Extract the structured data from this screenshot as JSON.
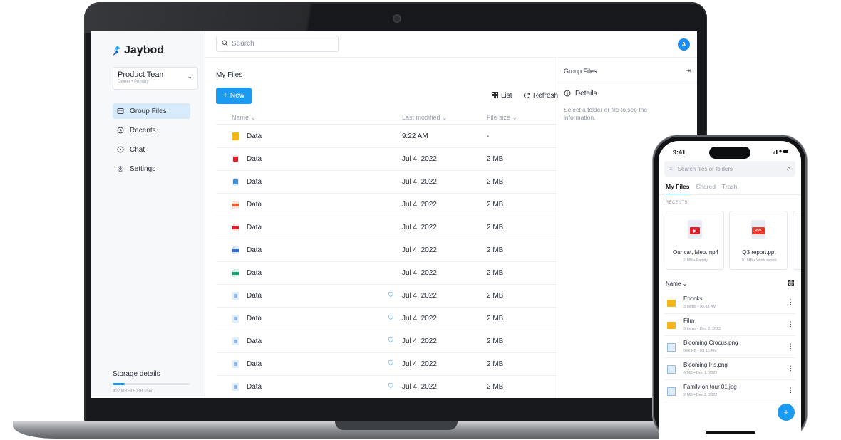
{
  "app": {
    "logo_text": "Jaybod",
    "colors": {
      "accent": "#1a9af0",
      "sidebar_bg": "#f7f8fa",
      "folder": "#f3b619",
      "danger": "#e1202c"
    }
  },
  "team": {
    "name": "Product Team",
    "subtitle": "Owner • Primary"
  },
  "sidebar": {
    "items": [
      {
        "label": "Group Files",
        "icon": "folder-icon",
        "active": true
      },
      {
        "label": "Recents",
        "icon": "clock-icon"
      },
      {
        "label": "Chat",
        "icon": "chat-icon"
      },
      {
        "label": "Settings",
        "icon": "gear-icon"
      }
    ],
    "storage_title": "Storage details",
    "storage_text": "802 MB of 5 GB used.",
    "storage_fraction": 0.16
  },
  "topbar": {
    "search_placeholder": "Search",
    "avatar_letter": "A"
  },
  "main": {
    "title": "My Files",
    "new_label": "New",
    "view_label": "List",
    "refresh_label": "Refresh",
    "columns": {
      "name": "Name",
      "modified": "Last modified",
      "size": "File size"
    },
    "rows": [
      {
        "name": "Data",
        "type": "folder",
        "date": "9:22 AM",
        "size": "-",
        "shared": false
      },
      {
        "name": "Data",
        "type": "video",
        "date": "Jul 4, 2022",
        "size": "2 MB",
        "shared": false
      },
      {
        "name": "Data",
        "type": "img",
        "date": "Jul 4, 2022",
        "size": "2 MB",
        "shared": false
      },
      {
        "name": "Data",
        "type": "ppt",
        "date": "Jul 4, 2022",
        "size": "2 MB",
        "shared": false
      },
      {
        "name": "Data",
        "type": "pdf",
        "date": "Jul 4, 2022",
        "size": "2 MB",
        "shared": false
      },
      {
        "name": "Data",
        "type": "doc",
        "date": "Jul 4, 2022",
        "size": "2 MB",
        "shared": false
      },
      {
        "name": "Data",
        "type": "xls",
        "date": "Jul 4, 2022",
        "size": "2 MB",
        "shared": false
      },
      {
        "name": "Data",
        "type": "file",
        "date": "Jul 4, 2022",
        "size": "2 MB",
        "shared": true
      },
      {
        "name": "Data",
        "type": "file",
        "date": "Jul 4, 2022",
        "size": "2 MB",
        "shared": true
      },
      {
        "name": "Data",
        "type": "file",
        "date": "Jul 4, 2022",
        "size": "2 MB",
        "shared": true
      },
      {
        "name": "Data",
        "type": "file",
        "date": "Jul 4, 2022",
        "size": "2 MB",
        "shared": true
      },
      {
        "name": "Data",
        "type": "file",
        "date": "Jul 4, 2022",
        "size": "2 MB",
        "shared": true
      }
    ]
  },
  "details": {
    "title": "Group Files",
    "section": "Details",
    "message": "Select a folder or file to see the information."
  },
  "phone": {
    "time": "9:41",
    "status_icons": "signal-wifi-battery",
    "search_placeholder": "Search files or folders",
    "tabs": [
      "My Files",
      "Shared",
      "Trash"
    ],
    "recents_label": "RECENTS",
    "recent_cards": [
      {
        "name": "Our cat, Meo.mp4",
        "meta": "2 MB • Family",
        "badge": "▶"
      },
      {
        "name": "Q3 report.ppt",
        "meta": "10 MB • Work report",
        "badge": "PPT"
      }
    ],
    "sort_label": "Name",
    "items": [
      {
        "name": "Ebooks",
        "meta": "3 items • 09.43 AM",
        "type": "folder"
      },
      {
        "name": "Film",
        "meta": "3 items • Dec 2, 2022",
        "type": "folder"
      },
      {
        "name": "Blooming Crocus.png",
        "meta": "559 KB • 03.15 PM",
        "type": "image"
      },
      {
        "name": "Blooming Iris.png",
        "meta": "4 MB • Dec 1, 2022",
        "type": "image"
      },
      {
        "name": "Family on tour 01.jpg",
        "meta": "2 MB • Dec 2, 2022",
        "type": "image"
      }
    ],
    "fab_label": "+"
  }
}
